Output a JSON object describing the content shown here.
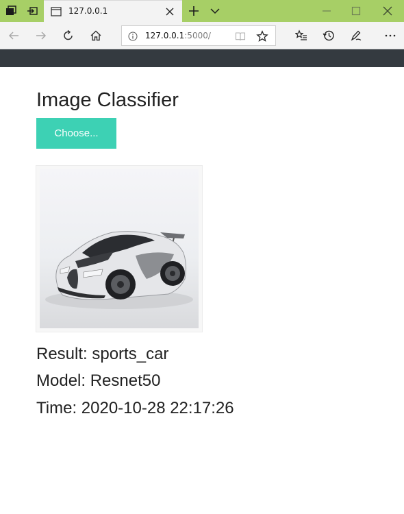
{
  "browser": {
    "tab_title": "127.0.0.1",
    "address": {
      "host": "127.0.0.1",
      "path": ":5000/"
    },
    "colors": {
      "tabstrip": "#a7cf66",
      "toolbar": "#f3f3f3",
      "site_navbar": "#343a40"
    }
  },
  "page": {
    "title": "Image Classifier",
    "choose_button": "Choose...",
    "button_color": "#3dd1b4",
    "result_line": "Result: sports_car",
    "model_line": "Model: Resnet50",
    "time_line": "Time: 2020-10-28 22:17:26"
  },
  "icons": {
    "tab_strip_left": [
      "tabs-aside-icon",
      "set-aside-tabs-icon"
    ],
    "tab": "page-icon",
    "toolbar": [
      "back-arrow-icon",
      "forward-arrow-icon",
      "refresh-icon",
      "home-icon",
      "info-icon",
      "reading-view-icon",
      "favorite-star-icon",
      "favorites-list-icon",
      "history-icon",
      "pen-icon",
      "more-icon"
    ]
  }
}
